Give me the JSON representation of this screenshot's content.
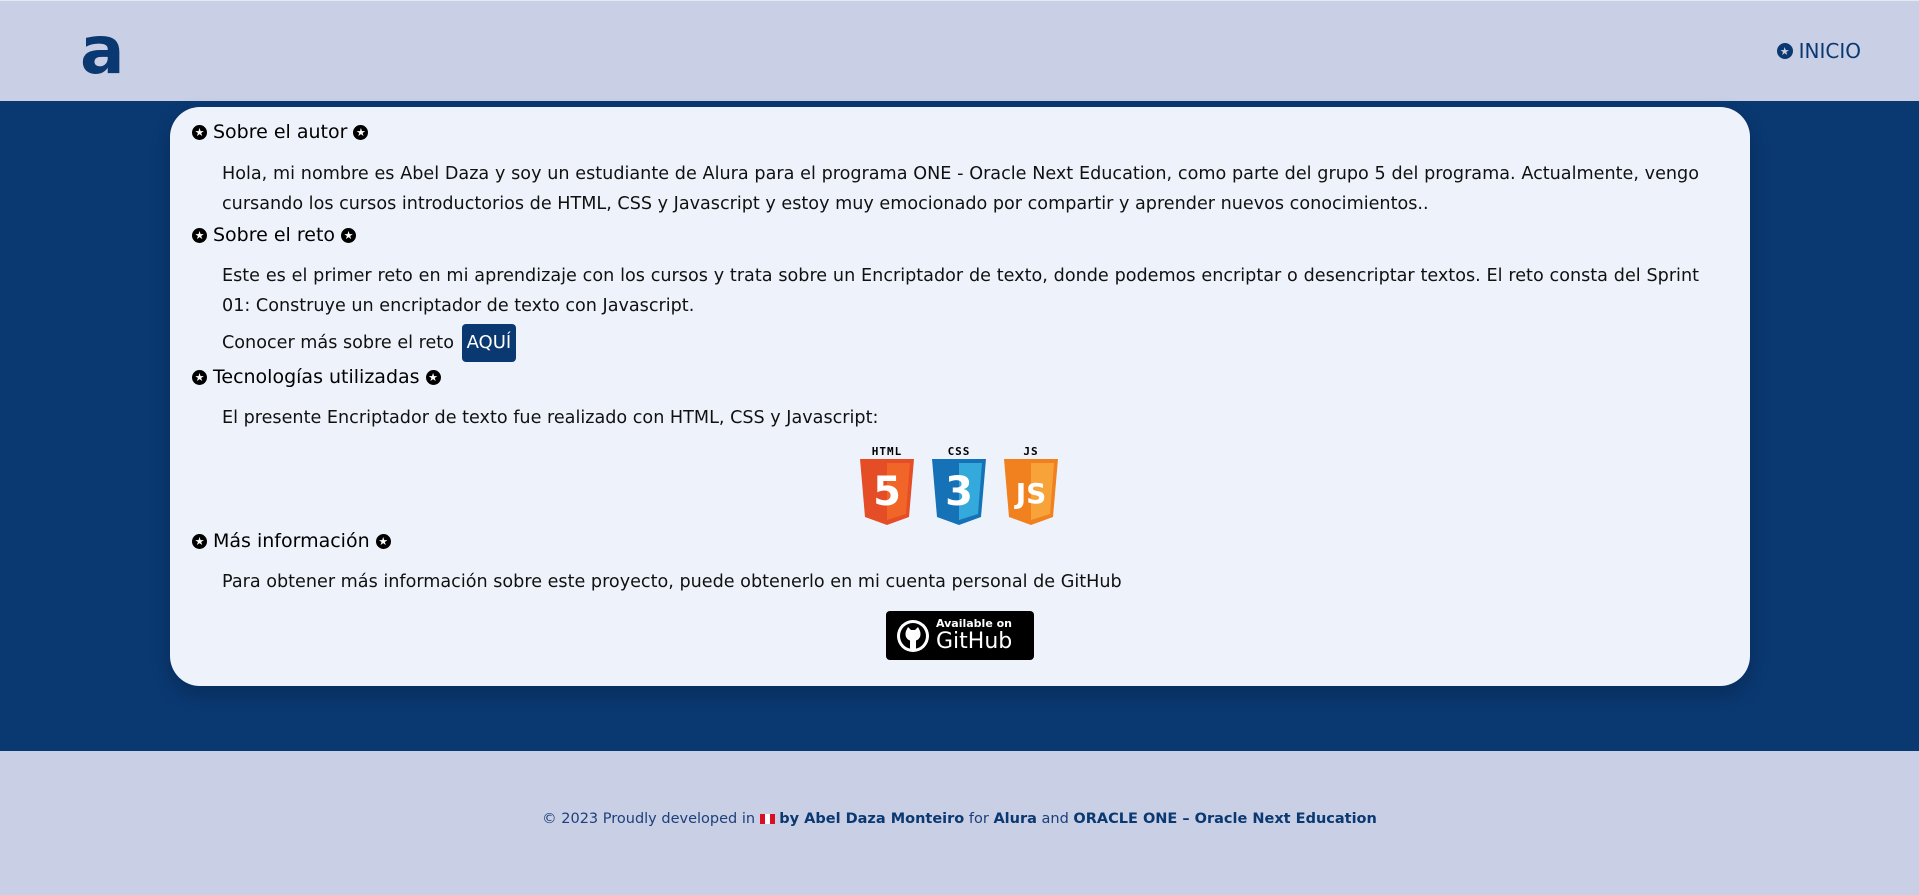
{
  "header": {
    "logo": "a",
    "nav_inicio": "INICIO",
    "nav_icon": "star-circle-icon"
  },
  "sections": [
    {
      "title": "Sobre el autor",
      "paragraphs": [
        "Hola, mi nombre es Abel Daza y soy un estudiante de Alura para el programa ONE - Oracle Next Education, como parte del grupo 5 del programa. Actualmente, vengo cursando los cursos introductorios de HTML, CSS y Javascript y estoy muy emocionado por compartir y aprender nuevos conocimientos.."
      ]
    },
    {
      "title": "Sobre el reto",
      "paragraphs": [
        "Este es el primer reto en mi aprendizaje con los cursos y trata sobre un Encriptador de texto, donde podemos encriptar o desencriptar textos. El reto consta del Sprint 01: Construye un encriptador de texto con Javascript."
      ],
      "more_text": "Conocer más sobre el reto",
      "more_button": "AQUÍ"
    },
    {
      "title": "Tecnologías utilizadas",
      "paragraphs": [
        "El presente Encriptador de texto fue realizado con HTML, CSS y Javascript:"
      ],
      "tech": [
        {
          "label": "HTML",
          "glyph": "5",
          "color": "#e44d26",
          "shade": "#f16529"
        },
        {
          "label": "CSS",
          "glyph": "3",
          "color": "#1572b6",
          "shade": "#33a9dc"
        },
        {
          "label": "JS",
          "glyph": "JS",
          "color": "#f0811e",
          "shade": "#f7a33a"
        }
      ]
    },
    {
      "title": "Más información",
      "paragraphs": [
        "Para obtener más información sobre este proyecto, puede obtenerlo en mi cuenta personal de GitHub"
      ],
      "github_small": "Available on",
      "github_big": "GitHub"
    }
  ],
  "footer": {
    "prefix": "© 2023 Proudly developed in",
    "by": "by Abel Daza Monteiro",
    "for": "for",
    "alura": "Alura",
    "and": "and",
    "oracle": "ORACLE ONE – Oracle Next Education"
  },
  "colors": {
    "primary": "#0a3871",
    "header_bg": "#c9cfe5",
    "card_bg": "#eef3fb"
  }
}
